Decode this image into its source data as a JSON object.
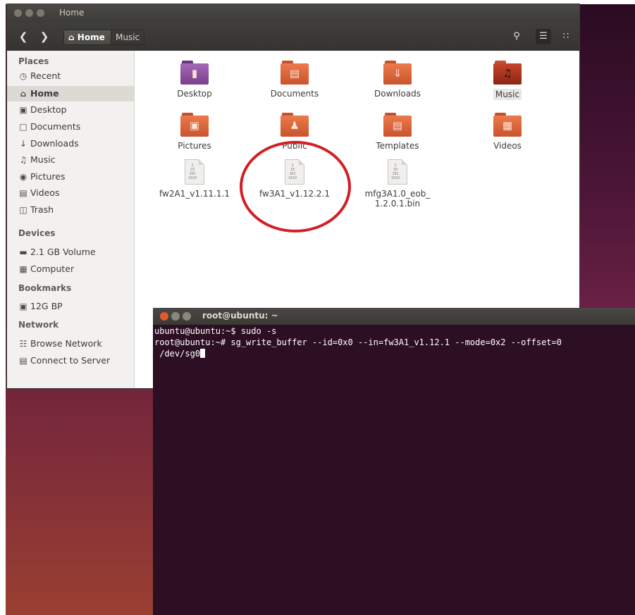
{
  "file_manager": {
    "title": "Home",
    "breadcrumb": {
      "home": "Home",
      "music": "Music"
    },
    "toolbar_icons": [
      "search-icon",
      "list-view-icon",
      "grid-view-icon"
    ],
    "sidebar": {
      "places_heading": "Places",
      "places": [
        {
          "label": "Recent",
          "icon": "clock-icon"
        },
        {
          "label": "Home",
          "icon": "home-icon"
        },
        {
          "label": "Desktop",
          "icon": "folder-icon"
        },
        {
          "label": "Documents",
          "icon": "document-icon"
        },
        {
          "label": "Downloads",
          "icon": "download-icon"
        },
        {
          "label": "Music",
          "icon": "music-icon"
        },
        {
          "label": "Pictures",
          "icon": "camera-icon"
        },
        {
          "label": "Videos",
          "icon": "film-icon"
        },
        {
          "label": "Trash",
          "icon": "trash-icon"
        }
      ],
      "devices_heading": "Devices",
      "devices": [
        {
          "label": "2.1 GB Volume",
          "icon": "drive-icon"
        },
        {
          "label": "Computer",
          "icon": "computer-icon"
        }
      ],
      "bookmarks_heading": "Bookmarks",
      "bookmarks": [
        {
          "label": "12G BP",
          "icon": "folder-icon"
        }
      ],
      "network_heading": "Network",
      "network": [
        {
          "label": "Browse Network",
          "icon": "network-icon"
        },
        {
          "label": "Connect to Server",
          "icon": "server-icon"
        }
      ]
    },
    "items": [
      {
        "label": "Desktop"
      },
      {
        "label": "Documents"
      },
      {
        "label": "Downloads"
      },
      {
        "label": "Music"
      },
      {
        "label": "Pictures"
      },
      {
        "label": "Public"
      },
      {
        "label": "Templates"
      },
      {
        "label": "Videos"
      },
      {
        "label": "fw2A1_v1.11.1.1"
      },
      {
        "label": "fw3A1_v1.12.2.1"
      },
      {
        "label": "mfg3A1.0_eob_",
        "label2": "1.2.0.1.bin"
      }
    ],
    "annotation_color": "#d21f26"
  },
  "terminal": {
    "title": "root@ubuntu: ~",
    "lines": [
      "ubuntu@ubuntu:~$ sudo -s",
      "root@ubuntu:~# sg_write_buffer --id=0x0 --in=fw3A1_v1.12.1 --mode=0x2 --offset=0",
      " /dev/sg0"
    ]
  }
}
